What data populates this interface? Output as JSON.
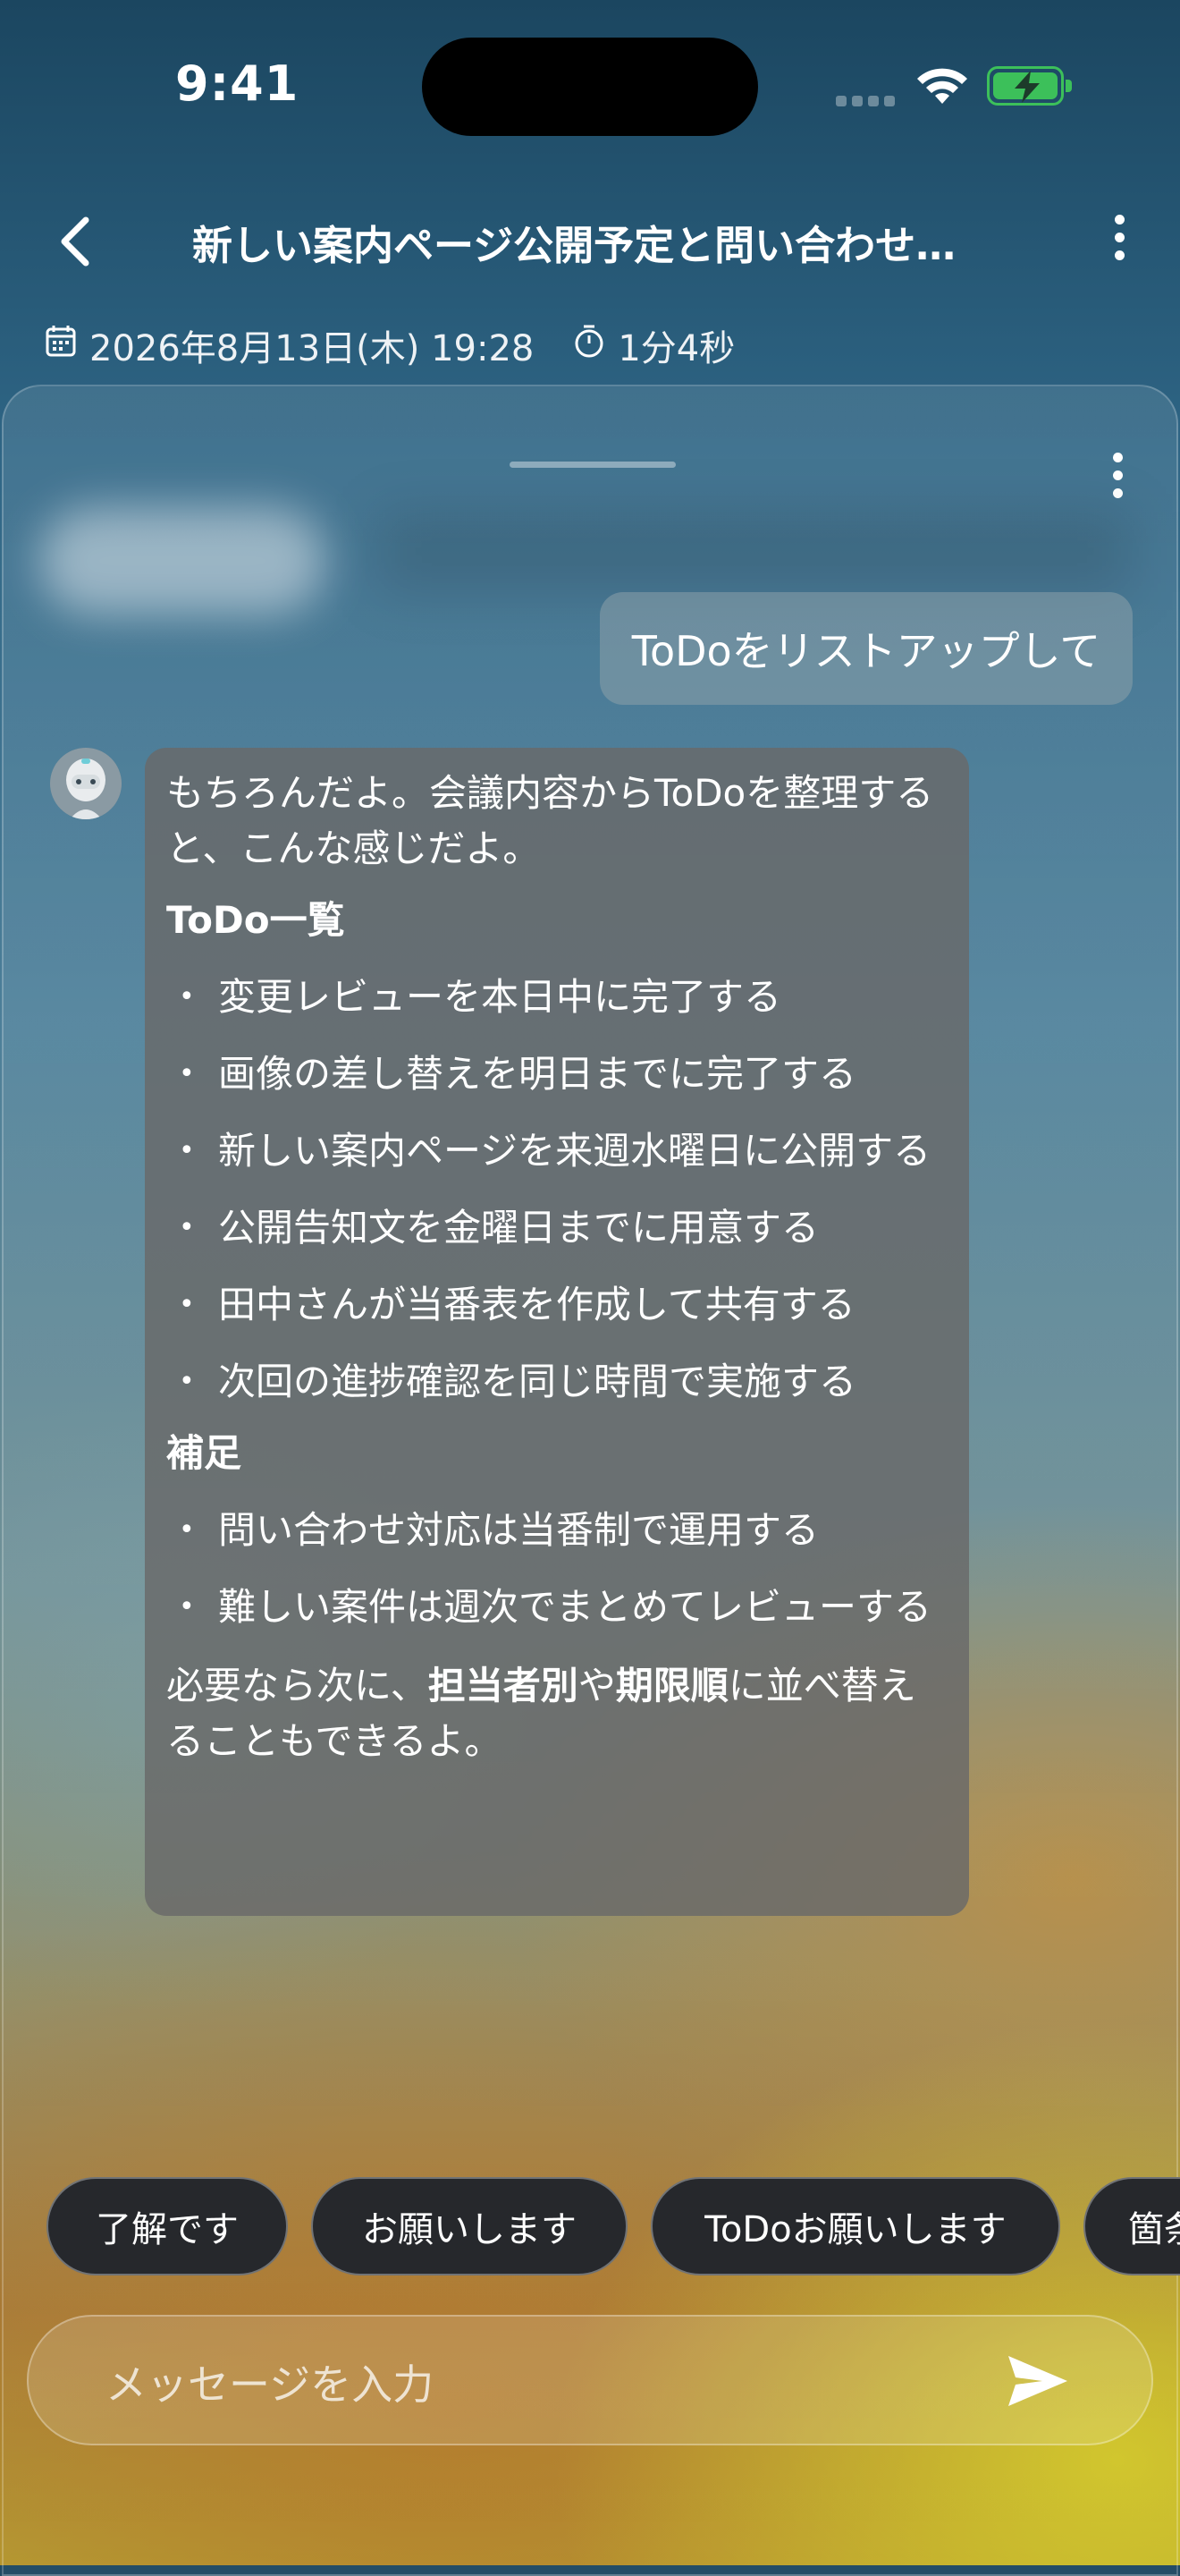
{
  "status": {
    "time": "9:41"
  },
  "header": {
    "title": "新しい案内ページ公開予定と問い合わせ…",
    "date": "2026年8月13日(木) 19:28",
    "duration": "1分4秒"
  },
  "chat": {
    "user_message": "ToDoをリストアップして",
    "bot": {
      "intro": "もちろんだよ。会議内容からToDoを整理すると、こんな感じだよ。",
      "section1_title": "ToDo一覧",
      "todos": [
        "変更レビューを本日中に完了する",
        "画像の差し替えを明日までに完了する",
        "新しい案内ページを来週水曜日に公開する",
        "公開告知文を金曜日までに用意する",
        "田中さんが当番表を作成して共有する",
        "次回の進捗確認を同じ時間で実施する"
      ],
      "section2_title": "補足",
      "notes": [
        "問い合わせ対応は当番制で運用する",
        "難しい案件は週次でまとめてレビューする"
      ],
      "closing_1": "必要なら次に、",
      "closing_bold_1": "担当者別",
      "closing_2": "や",
      "closing_bold_2": "期限順",
      "closing_3": "に並べ替えることもできるよ。"
    }
  },
  "quick_replies": [
    "了解です",
    "お願いします",
    "ToDoお願いします",
    "箇条"
  ],
  "input": {
    "placeholder": "メッセージを入力"
  }
}
